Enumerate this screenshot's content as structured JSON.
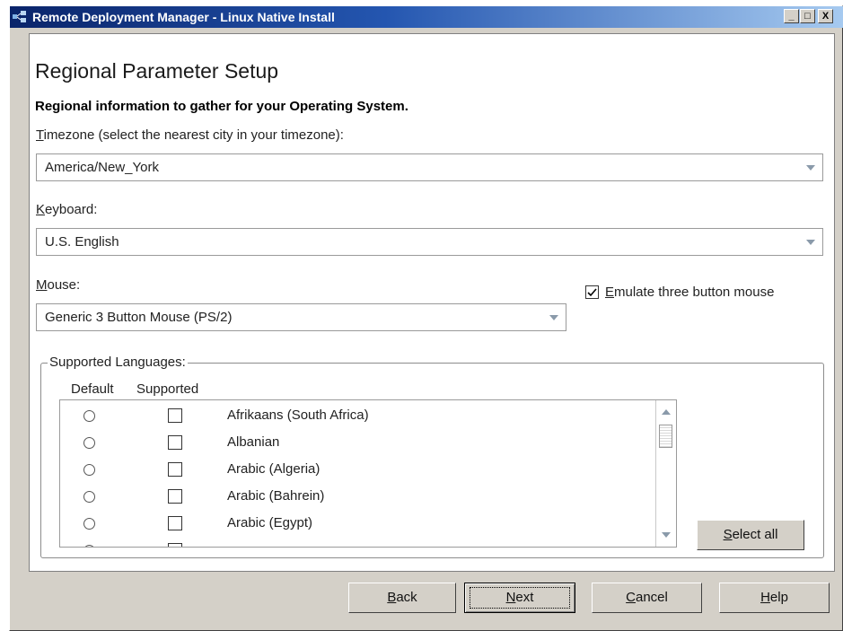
{
  "window": {
    "title": "Remote Deployment Manager - Linux Native Install",
    "minimize": "_",
    "maximize": "□",
    "close": "X"
  },
  "page": {
    "heading": "Regional Parameter Setup",
    "subheading": "Regional information to gather for your Operating System."
  },
  "timezone": {
    "label_key": "T",
    "label_rest": "imezone (select the nearest city in your timezone):",
    "value": "America/New_York"
  },
  "keyboard": {
    "label_key": "K",
    "label_rest": "eyboard:",
    "value": "U.S. English"
  },
  "mouse": {
    "label_key": "M",
    "label_rest": "ouse:",
    "value": "Generic 3 Button Mouse (PS/2)",
    "emulate_key": "E",
    "emulate_rest": "mulate three button mouse",
    "emulate_checked": true
  },
  "languages": {
    "legend": "Supported Languages:",
    "col_default": "Default",
    "col_supported": "Supported",
    "items": [
      "Afrikaans (South Africa)",
      "Albanian",
      "Arabic (Algeria)",
      "Arabic (Bahrein)",
      "Arabic (Egypt)"
    ],
    "select_all_key": "S",
    "select_all_rest": "elect all"
  },
  "buttons": {
    "back_key": "B",
    "back_rest": "ack",
    "next_key": "N",
    "next_rest": "ext",
    "cancel_key": "C",
    "cancel_rest": "ancel",
    "help_key": "H",
    "help_rest": "elp"
  }
}
